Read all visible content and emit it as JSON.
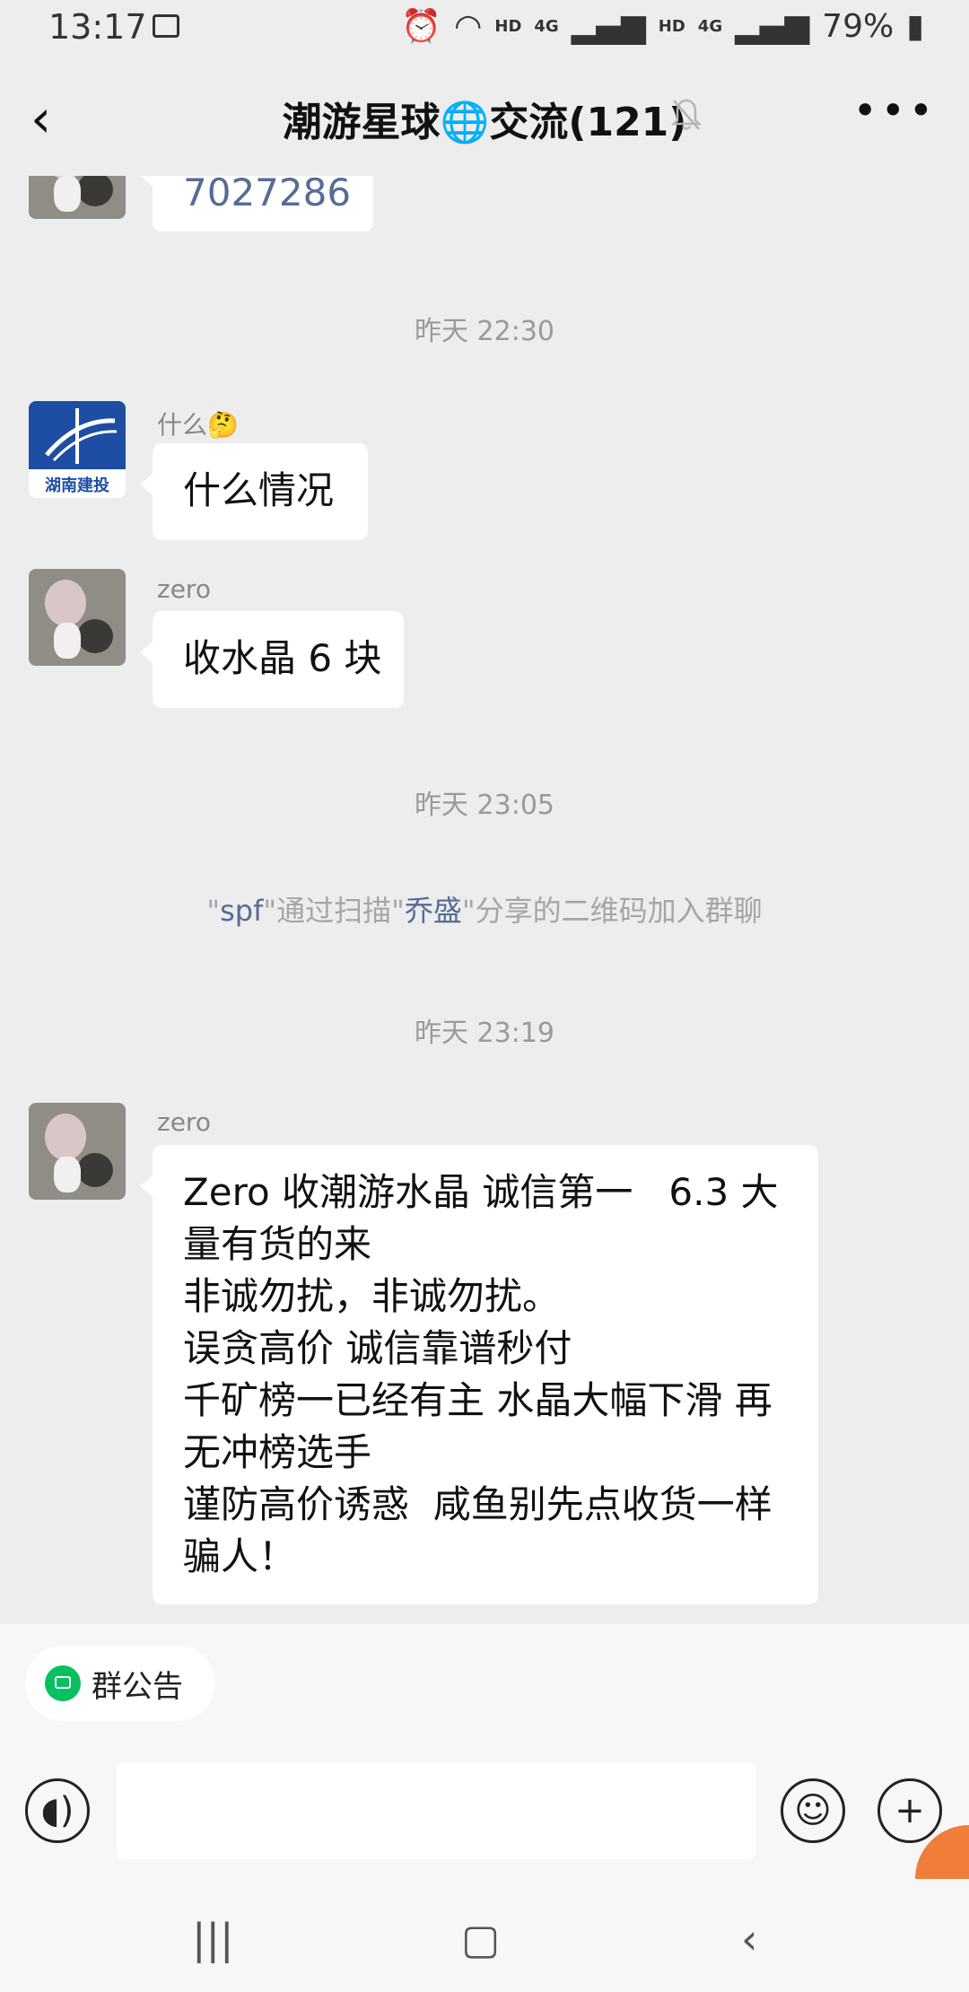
{
  "status_bar": {
    "time": "13:17",
    "network_label_1": "HD",
    "network_label_2": "4G",
    "network_label_3": "HD",
    "network_label_4": "4G",
    "battery": "79%"
  },
  "header": {
    "title": "潮游星球🌐交流(121)"
  },
  "messages": {
    "partial_bubble": "7027286",
    "ts1": "昨天 22:30",
    "msg1_sender": "什么🤔",
    "msg1_text": "什么情况",
    "msg1_avatar_label": "湖南建投",
    "msg2_sender": "zero",
    "msg2_text": "收水晶 6 块",
    "ts2": "昨天 23:05",
    "system": {
      "q1": "\"",
      "name1": "spf",
      "mid": "\"通过扫描\"",
      "name2": "乔盛",
      "tail": "\"分享的二维码加入群聊"
    },
    "ts3": "昨天 23:19",
    "msg3_sender": "zero",
    "msg3_lines": [
      "Zero 收潮游水晶 诚信第一   6.3 大",
      "量有货的来",
      "非诚勿扰，非诚勿扰。",
      "误贪高价 诚信靠谱秒付",
      "千矿榜一已经有主 水晶大幅下滑 再",
      "无冲榜选手",
      "谨防高价诱惑  咸鱼别先点收货一样",
      "骗人！"
    ]
  },
  "notice": {
    "label": "群公告"
  },
  "colors": {
    "accent_green": "#07c160",
    "link_blue": "#576b95",
    "bg": "#ededed"
  }
}
